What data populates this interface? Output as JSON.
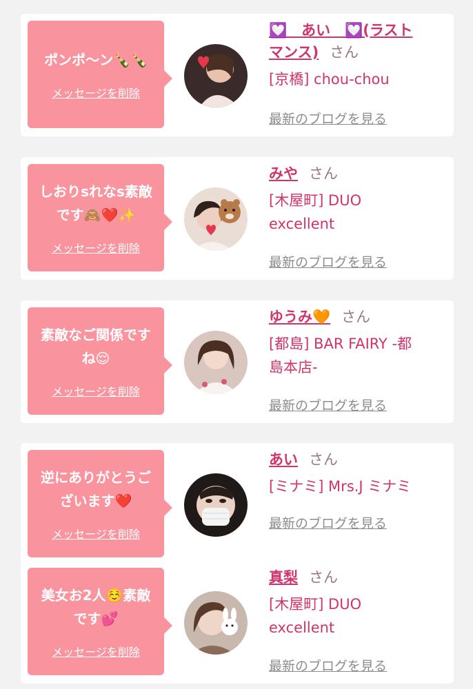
{
  "colors": {
    "background": "#f2f2f2",
    "bubble": "#f9949f",
    "name": "#d1336a",
    "shop": "#d1336a",
    "san": "#9b7686",
    "link_gray": "#8c8c8c"
  },
  "messages": [
    {
      "message_lines": [
        "ポンポ〜ン🍾🍾"
      ],
      "delete_label": "メッセージを削除",
      "name_lines": [
        "💟　あい　💟(ラスト",
        "マンス)"
      ],
      "honorific": "さん",
      "shop_lines": [
        "[京橋] chou-chou"
      ],
      "blog_label": "最新のブログを見る",
      "avatar_icon": "avatar-photo-icon"
    },
    {
      "message_lines": [
        "しおりsれなs素敵",
        "です🙈❤️✨"
      ],
      "delete_label": "メッセージを削除",
      "name_lines": [
        "みや"
      ],
      "honorific": "さん",
      "shop_lines": [
        "[木屋町] DUO",
        "excellent"
      ],
      "blog_label": "最新のブログを見る",
      "avatar_icon": "avatar-photo-icon"
    },
    {
      "message_lines": [
        "素敵なご関係です",
        "ね😌"
      ],
      "delete_label": "メッセージを削除",
      "name_lines": [
        "ゆうみ🧡"
      ],
      "honorific": "さん",
      "shop_lines": [
        "[都島] BAR FAIRY -都",
        "島本店-"
      ],
      "blog_label": "最新のブログを見る",
      "avatar_icon": "avatar-photo-icon"
    },
    {
      "message_lines": [
        "逆にありがとうご",
        "ざいます❤️"
      ],
      "delete_label": "メッセージを削除",
      "name_lines": [
        "あい"
      ],
      "honorific": "さん",
      "shop_lines": [
        "[ミナミ] Mrs.J ミナミ"
      ],
      "blog_label": "最新のブログを見る",
      "avatar_icon": "avatar-photo-icon"
    },
    {
      "message_lines": [
        "美女お2人☺️素敵",
        "です💕"
      ],
      "delete_label": "メッセージを削除",
      "name_lines": [
        "真梨"
      ],
      "honorific": "さん",
      "shop_lines": [
        "[木屋町] DUO",
        "excellent"
      ],
      "blog_label": "最新のブログを見る",
      "avatar_icon": "avatar-photo-icon"
    }
  ]
}
